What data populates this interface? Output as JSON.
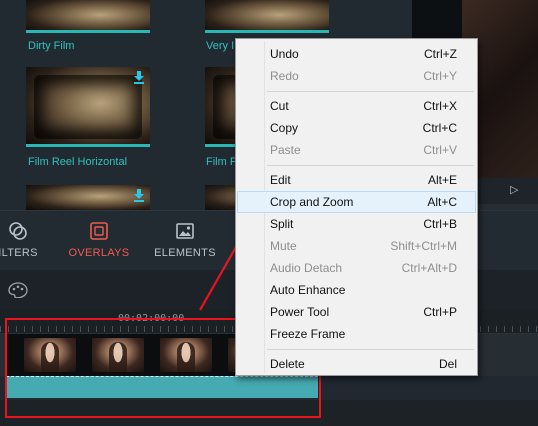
{
  "library": {
    "captions": {
      "dirty_film": "Dirty Film",
      "very": "Very I",
      "film_reel": "Film Reel Horizontal",
      "film_f": "Film F"
    }
  },
  "tabs": [
    {
      "label": "ILTERS",
      "icon": "filters-icon"
    },
    {
      "label": "OVERLAYS",
      "icon": "overlays-icon",
      "active": true
    },
    {
      "label": "ELEMENTS",
      "icon": "elements-icon"
    }
  ],
  "timeline": {
    "playhead_time": "00:02:00:00",
    "toolbar_icon": "palette-icon"
  },
  "context_menu": {
    "items": [
      {
        "label": "Undo",
        "shortcut": "Ctrl+Z",
        "enabled": true
      },
      {
        "label": "Redo",
        "shortcut": "Ctrl+Y",
        "enabled": false
      },
      {
        "label": "Cut",
        "shortcut": "Ctrl+X",
        "enabled": true
      },
      {
        "label": "Copy",
        "shortcut": "Ctrl+C",
        "enabled": true
      },
      {
        "label": "Paste",
        "shortcut": "Ctrl+V",
        "enabled": false
      },
      {
        "label": "Edit",
        "shortcut": "Alt+E",
        "enabled": true
      },
      {
        "label": "Crop and Zoom",
        "shortcut": "Alt+C",
        "enabled": true,
        "highlighted": true
      },
      {
        "label": "Split",
        "shortcut": "Ctrl+B",
        "enabled": true
      },
      {
        "label": "Mute",
        "shortcut": "Shift+Ctrl+M",
        "enabled": false
      },
      {
        "label": "Audio Detach",
        "shortcut": "Ctrl+Alt+D",
        "enabled": false
      },
      {
        "label": "Auto Enhance",
        "shortcut": "",
        "enabled": true
      },
      {
        "label": "Power Tool",
        "shortcut": "Ctrl+P",
        "enabled": true
      },
      {
        "label": "Freeze Frame",
        "shortcut": "",
        "enabled": true
      },
      {
        "label": "Delete",
        "shortcut": "Del",
        "enabled": true
      }
    ]
  },
  "colors": {
    "accent_teal": "#2ec1c0",
    "active_tab": "#ee5b4e",
    "annotation_red": "#e8141e",
    "audio_clip": "#45aab1"
  }
}
